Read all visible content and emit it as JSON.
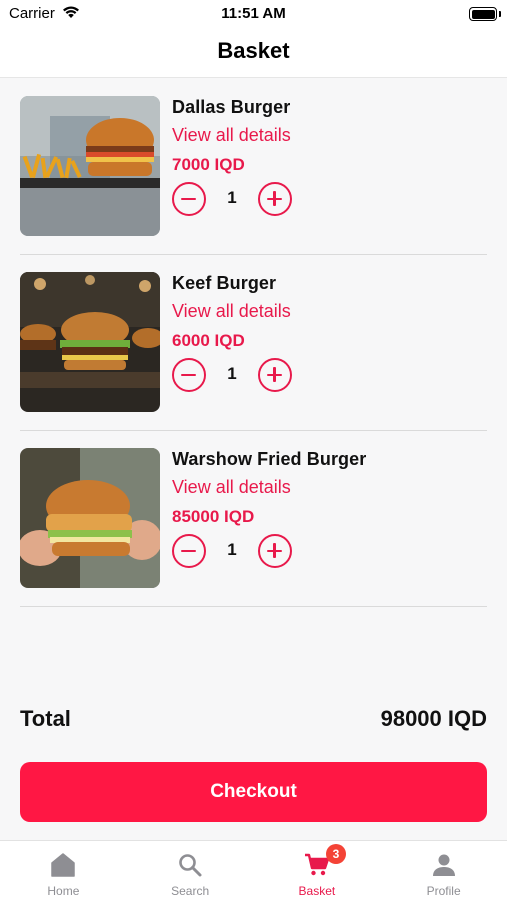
{
  "status_bar": {
    "carrier": "Carrier",
    "time": "11:51 AM"
  },
  "header": {
    "title": "Basket"
  },
  "items": [
    {
      "name": "Dallas Burger",
      "details_label": "View all details",
      "price": "7000 IQD",
      "quantity": "1",
      "image": "dallas-burger-photo"
    },
    {
      "name": "Keef Burger",
      "details_label": "View all details",
      "price": "6000 IQD",
      "quantity": "1",
      "image": "keef-burger-photo"
    },
    {
      "name": "Warshow Fried Burger",
      "details_label": "View all details",
      "price": "85000 IQD",
      "quantity": "1",
      "image": "warshow-fried-burger-photo"
    }
  ],
  "summary": {
    "total_label": "Total",
    "total_value": "98000 IQD"
  },
  "checkout": {
    "label": "Checkout"
  },
  "tab_bar": {
    "tabs": [
      {
        "label": "Home",
        "icon": "home-icon",
        "active": false
      },
      {
        "label": "Search",
        "icon": "search-icon",
        "active": false
      },
      {
        "label": "Basket",
        "icon": "cart-icon",
        "active": true
      },
      {
        "label": "Profile",
        "icon": "person-icon",
        "active": false
      }
    ],
    "basket_badge": "3"
  },
  "colors": {
    "accent": "#e8194b",
    "checkout": "#ff1744",
    "badge": "#f44336",
    "inactive": "#8e8e93"
  }
}
